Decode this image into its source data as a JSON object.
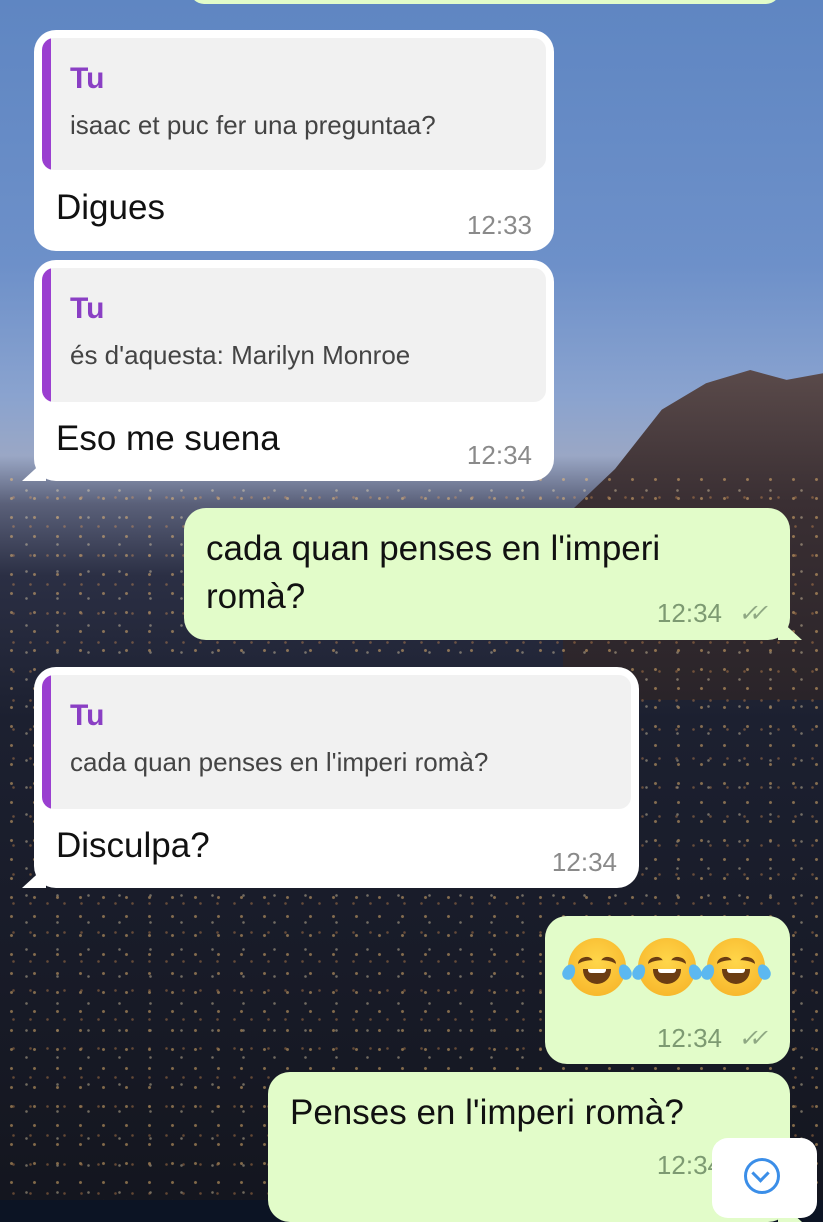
{
  "messages": [
    {
      "direction": "incoming",
      "quote": {
        "name": "Tu",
        "text": "isaac et puc fer una preguntaa?"
      },
      "text": "Digues",
      "time": "12:33"
    },
    {
      "direction": "incoming",
      "quote": {
        "name": "Tu",
        "text": "és d'aquesta: Marilyn Monroe"
      },
      "text": "Eso me suena",
      "time": "12:34"
    },
    {
      "direction": "outgoing",
      "text_line1": "cada quan penses en l'imperi",
      "text_line2": "romà?",
      "time": "12:34",
      "status": "read"
    },
    {
      "direction": "incoming",
      "quote": {
        "name": "Tu",
        "text": "cada quan penses en l'imperi romà?"
      },
      "text": "Disculpa?",
      "time": "12:34"
    },
    {
      "direction": "outgoing",
      "emojis": [
        "face-with-tears-of-joy",
        "face-with-tears-of-joy",
        "face-with-tears-of-joy"
      ],
      "time": "12:34",
      "status": "read"
    },
    {
      "direction": "outgoing",
      "text": "Penses en l'imperi romà?",
      "time": "12:34",
      "status": "read"
    }
  ],
  "colors": {
    "incoming_bubble": "#ffffff",
    "outgoing_bubble": "#e2fcc9",
    "quote_accent": "#9a3fd0",
    "quote_name": "#8a3fc4",
    "scroll_button_icon": "#3b8ee8"
  },
  "icons": {
    "read_status": "double-check-icon",
    "scroll_down": "scroll-down-icon"
  }
}
